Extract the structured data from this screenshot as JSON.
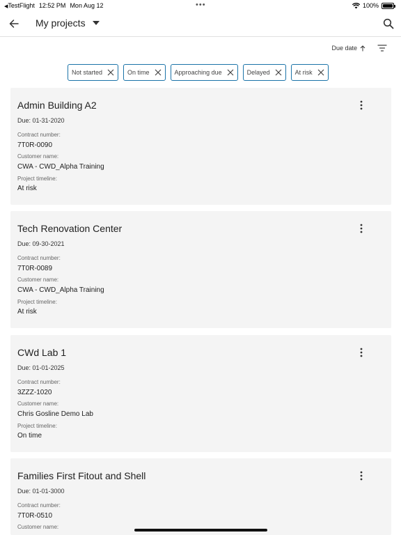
{
  "status_bar": {
    "back_app": "TestFlight",
    "time": "12:52 PM",
    "date": "Mon Aug 12",
    "battery": "100%"
  },
  "app_bar": {
    "title": "My projects",
    "back_icon": "arrow-left-icon",
    "search_icon": "search-icon"
  },
  "sort": {
    "label": "Due date",
    "direction_icon": "arrow-up-icon",
    "filter_icon": "filter-icon"
  },
  "chips": [
    {
      "label": "Not started"
    },
    {
      "label": "On time"
    },
    {
      "label": "Approaching due"
    },
    {
      "label": "Delayed"
    },
    {
      "label": "At risk"
    }
  ],
  "field_labels": {
    "contract": "Contract number:",
    "customer": "Customer name:",
    "timeline": "Project timeline:"
  },
  "projects": [
    {
      "title": "Admin Building A2",
      "due": "Due: 01-31-2020",
      "contract": "7T0R-0090",
      "customer": "CWA - CWD_Alpha Training",
      "timeline": "At risk"
    },
    {
      "title": "Tech Renovation Center",
      "due": "Due: 09-30-2021",
      "contract": "7T0R-0089",
      "customer": "CWA - CWD_Alpha Training",
      "timeline": "At risk"
    },
    {
      "title": "CWd Lab 1",
      "due": "Due: 01-01-2025",
      "contract": "3ZZZ-1020",
      "customer": "Chris Gosline Demo Lab",
      "timeline": "On time"
    },
    {
      "title": "Families First Fitout and Shell",
      "due": "Due: 01-01-3000",
      "contract": "7T0R-0510",
      "customer": "",
      "timeline": ""
    }
  ],
  "colors": {
    "chip_border": "#1a73a8",
    "card_background": "#f4f4f4"
  }
}
